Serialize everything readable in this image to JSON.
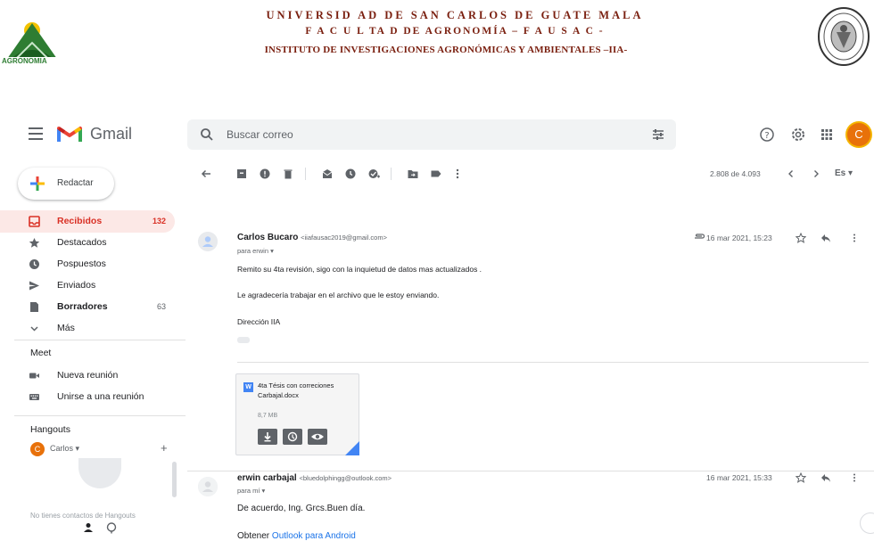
{
  "letterhead": {
    "line1": "UNIVERSID AD  DE   SAN CARLOS DE GUATE MALA",
    "line2": "F A C U L TA D  DE  AGRONOMÍA  – F A U S A C -",
    "line3": "INSTITUTO DE INVESTIGACIONES AGRONÓMICAS Y AMBIENTALES –IIA-",
    "logo_left_text": "AGRONOMIA"
  },
  "topbar": {
    "app_name": "Gmail",
    "search_placeholder": "Buscar correo",
    "avatar_letter": "C"
  },
  "sidebar": {
    "compose_label": "Redactar",
    "items": [
      {
        "label": "Recibidos",
        "count": "132",
        "icon": "inbox-icon"
      },
      {
        "label": "Destacados",
        "count": "",
        "icon": "star-icon"
      },
      {
        "label": "Pospuestos",
        "count": "",
        "icon": "clock-icon"
      },
      {
        "label": "Enviados",
        "count": "",
        "icon": "send-icon"
      },
      {
        "label": "Borradores",
        "count": "63",
        "icon": "draft-icon"
      },
      {
        "label": "Más",
        "count": "",
        "icon": "chevron-down-icon"
      }
    ],
    "meet_title": "Meet",
    "meet_items": [
      "Nueva reunión",
      "Unirse a una reunión"
    ],
    "hangouts_title": "Hangouts",
    "hangouts_user": "Carlos ▾",
    "hangouts_avatar": "C",
    "no_contacts": "No tienes contactos de Hangouts"
  },
  "toolbar": {
    "pager": "2.808 de 4.093",
    "lang": "Es ▾"
  },
  "messages": [
    {
      "sender_name": "Carlos Bucaro",
      "sender_email": "<iiafausac2019@gmail.com>",
      "recipient": "para erwin ▾",
      "date": "16 mar 2021, 15:23",
      "lines": [
        "Remito su 4ta revisión, sigo con la inquietud de datos mas actualizados .",
        "Le agradecería trabajar en el archivo que le estoy enviando.",
        "Dirección IIA"
      ],
      "attachment": {
        "name": "4ta Tésis con correciones Carbajal.docx",
        "size": "8,7 MB",
        "type_letter": "W"
      }
    },
    {
      "sender_name": "erwin carbajal",
      "sender_email": "<bluedolphingg@outlook.com>",
      "recipient": "para mí ▾",
      "date": "16 mar 2021, 15:33",
      "lines": [
        "De acuerdo, Ing. Grcs.Buen día."
      ],
      "footer_prefix": "Obtener ",
      "footer_link": "Outlook para Android"
    }
  ],
  "colors": {
    "gmail_red": "#d93025",
    "active_bg": "#fce8e6",
    "link": "#1a73e8",
    "letterhead": "#7a1f0f",
    "avatar": "#e8710a"
  }
}
